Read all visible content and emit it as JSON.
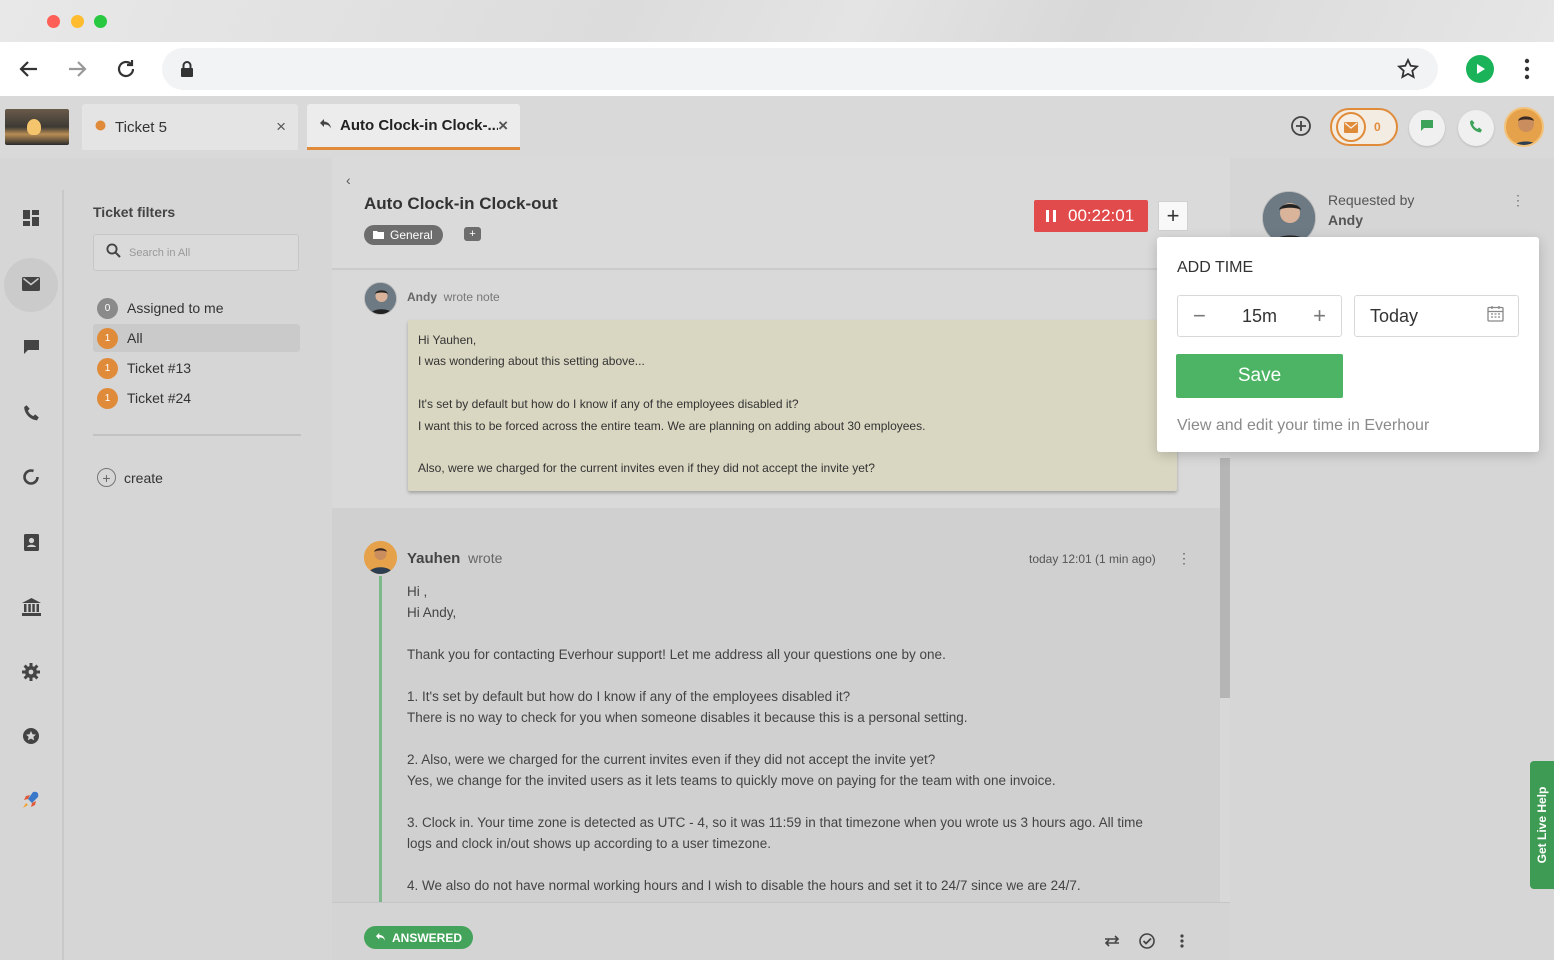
{
  "app": {
    "tabs": [
      {
        "label": "Ticket 5",
        "close": "×"
      },
      {
        "label": "Auto Clock-in Clock-...",
        "close": "×"
      }
    ],
    "mail_count": "0"
  },
  "filters": {
    "title": "Ticket filters",
    "search_placeholder": "Search in All",
    "items": [
      {
        "badge": "0",
        "label": "Assigned to me"
      },
      {
        "badge": "1",
        "label": "All"
      },
      {
        "badge": "1",
        "label": "Ticket #13"
      },
      {
        "badge": "1",
        "label": "Ticket #24"
      }
    ],
    "create_label": "create"
  },
  "ticket": {
    "title": "Auto Clock-in Clock-out",
    "tag": "General",
    "timer": "00:22:01",
    "note": {
      "author": "Andy",
      "action": "wrote note",
      "lines": [
        "Hi Yauhen,",
        "I was wondering about this setting above...",
        "",
        "It's set by default but how do I know if any of the employees disabled it?",
        "I want this to be forced across the entire team. We are planning on adding about 30 employees.",
        "",
        "Also, were we charged for the current invites even if they did not accept the invite yet?"
      ]
    },
    "reply": {
      "author": "Yauhen",
      "action": "wrote",
      "time": "today 12:01 (1 min ago)",
      "lines": [
        "Hi ,",
        "Hi Andy,",
        "",
        "Thank you for contacting Everhour support! Let me address all your questions one by one.",
        "",
        "1. It's set by default but how do I know if any of the employees disabled it?",
        "There is no way to check for you when someone disables it because this is a personal setting.",
        "",
        "2. Also, were we charged for the current invites even if they did not accept the invite yet?",
        "Yes, we change for the invited users as it lets teams to quickly move on paying for the team with one invoice.",
        "",
        "3. Clock in. Your time zone is detected as UTC - 4, so it was 11:59 in that timezone when you wrote us 3 hours ago. All time",
        "logs and clock in/out shows up according to a user timezone.",
        "",
        "4. We also do not have normal working hours and I wish to disable the hours and set it to 24/7 since we are 24/7."
      ]
    },
    "status": "ANSWERED"
  },
  "requester": {
    "label": "Requested by",
    "name": "Andy"
  },
  "add_time": {
    "title": "ADD TIME",
    "duration": "15m",
    "date": "Today",
    "save_label": "Save",
    "link": "View and edit your time in Everhour"
  },
  "live_help": "Get Live Help",
  "colors": {
    "accent_orange": "#e08b3a",
    "timer_red": "#e14b4b",
    "save_green": "#4cb464",
    "answered_green": "#44a35a"
  }
}
